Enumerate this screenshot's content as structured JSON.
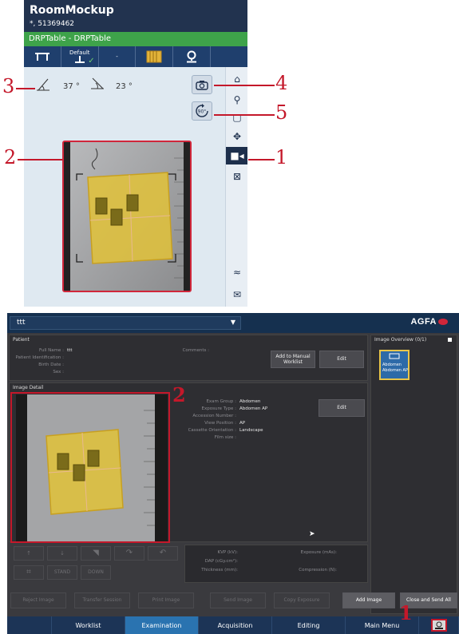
{
  "top_app": {
    "title": "RoomMockup",
    "subtitle": "*, 51369462",
    "room": "DRPTable - DRPTable",
    "toolbar": {
      "default_label": "Default",
      "dash": "-"
    },
    "angles": {
      "tilt": "37 °",
      "rotation": "23 °"
    }
  },
  "annotations": {
    "n1": "1",
    "n2": "2",
    "n3": "3",
    "n4": "4",
    "n5": "5",
    "b2": "2",
    "b1": "1"
  },
  "bottom_app": {
    "patient_select": "ttt",
    "logo": "AGFA",
    "patient_panel": {
      "title": "Patient",
      "fields": [
        {
          "label": "Full Name :",
          "value": "ttt"
        },
        {
          "label": "Patient Identification :",
          "value": ""
        },
        {
          "label": "Birth Date :",
          "value": ""
        },
        {
          "label": "Sex :",
          "value": ""
        }
      ],
      "comments_label": "Comments :",
      "add_worklist": "Add to Manual Worklist",
      "edit": "Edit"
    },
    "overview": {
      "title": "Image Overview (0/1)",
      "thumb_line1": "Abdomen",
      "thumb_line2": "Abdomen AP"
    },
    "image_detail": {
      "title": "Image Detail",
      "fields": [
        {
          "label": "Exam Group :",
          "value": "Abdomen"
        },
        {
          "label": "Exposure Type :",
          "value": "Abdomen AP"
        },
        {
          "label": "Accession Number :",
          "value": ""
        },
        {
          "label": "View Position :",
          "value": "AP"
        },
        {
          "label": "Cassette Orientation :",
          "value": "Landscape"
        },
        {
          "label": "Film size :",
          "value": ""
        }
      ],
      "edit": "Edit"
    },
    "tools": {
      "stand": "STAND",
      "down": "DOWN"
    },
    "exposure": {
      "kvp": "KVP (kV):",
      "dap": "DAP (cGy.cm²):",
      "thickness": "Thickness (mm):",
      "exposure_mas": "Exposure (mAs):",
      "compression": "Compression (N):"
    },
    "actions": [
      "Reject Image",
      "Transfer Session",
      "Print Image",
      "Send Image",
      "Copy Exposure",
      "Add Image",
      "Close and Send All"
    ],
    "tabs": [
      "Worklist",
      "Examination",
      "Acquisition",
      "Editing",
      "Main Menu"
    ]
  },
  "colors": {
    "annotation_red": "#c4182a",
    "navy": "#22334f",
    "green": "#3ea34a",
    "tab_active": "#2a73b0"
  }
}
